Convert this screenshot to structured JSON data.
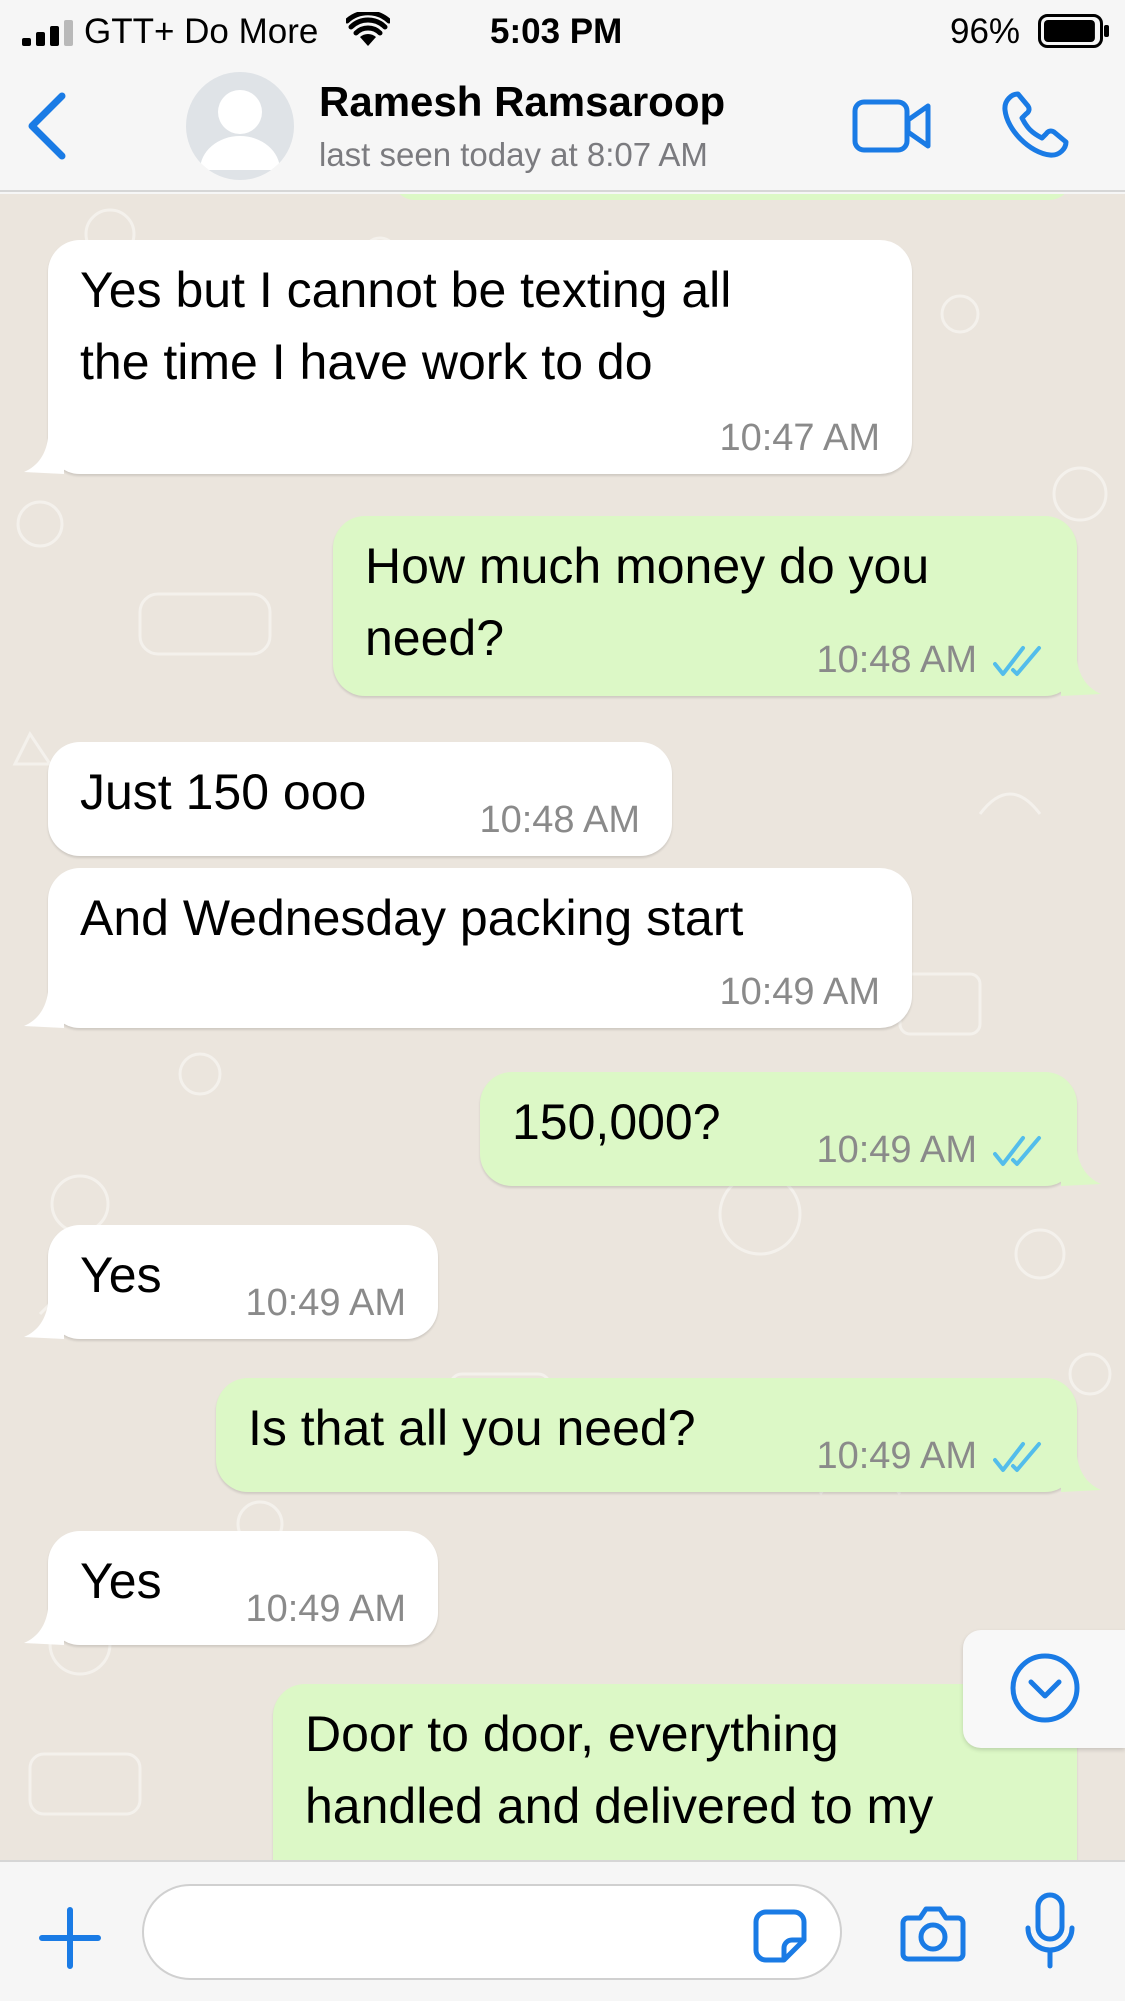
{
  "status_bar": {
    "carrier": "GTT+ Do More",
    "time": "5:03 PM",
    "battery_percent": "96%",
    "signal_bars": 4,
    "battery_level": 0.96
  },
  "header": {
    "back_icon": "chevron-left-icon",
    "contact_name": "Ramesh Ramsaroop",
    "last_seen": "last seen today at 8:07 AM",
    "video_icon": "video-camera-icon",
    "call_icon": "phone-icon"
  },
  "messages": [
    {
      "direction": "in",
      "text": "Yes but I cannot be texting all\nthe time I have work to do",
      "time": "10:47 AM"
    },
    {
      "direction": "out",
      "text": "How much money do you\nneed?",
      "time": "10:48 AM",
      "status": "read"
    },
    {
      "direction": "in",
      "text": "Just 150 ooo",
      "time": "10:48 AM"
    },
    {
      "direction": "in",
      "text": "And Wednesday packing start",
      "time": "10:49 AM"
    },
    {
      "direction": "out",
      "text": "150,000?",
      "time": "10:49 AM",
      "status": "read"
    },
    {
      "direction": "in",
      "text": "Yes",
      "time": "10:49 AM"
    },
    {
      "direction": "out",
      "text": "Is that all you need?",
      "time": "10:49 AM",
      "status": "read"
    },
    {
      "direction": "in",
      "text": "Yes",
      "time": "10:49 AM"
    },
    {
      "direction": "out",
      "text": "Door to door, everything\nhandled and delivered to my",
      "time": "",
      "status": ""
    }
  ],
  "input_bar": {
    "plus_icon": "plus-icon",
    "message_placeholder": "",
    "sticker_icon": "sticker-icon",
    "camera_icon": "camera-icon",
    "mic_icon": "microphone-icon"
  },
  "colors": {
    "accent": "#1a7be5",
    "incoming_bubble": "#ffffff",
    "outgoing_bubble": "#dcf8c6",
    "chat_background": "#ebe5dd",
    "read_ticks": "#53bdeb",
    "timestamp": "#8a8a8a"
  }
}
